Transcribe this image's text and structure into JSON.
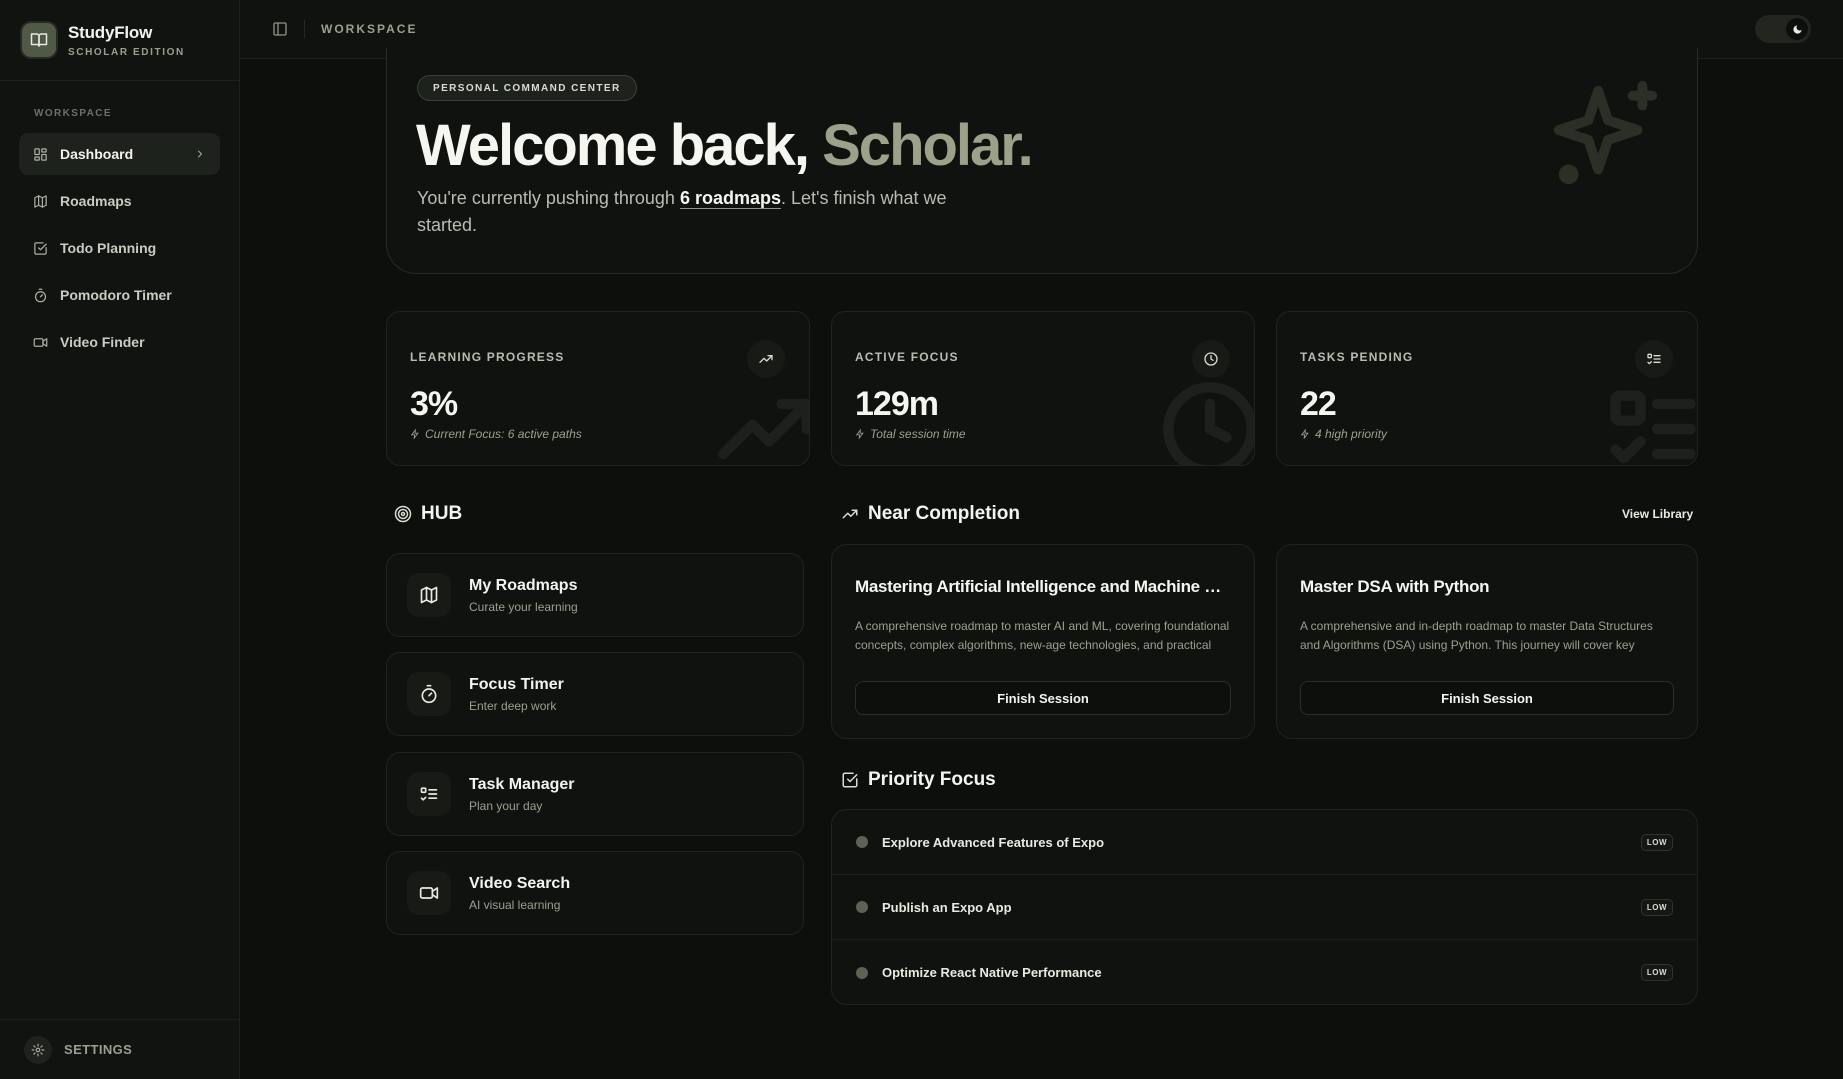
{
  "brand": {
    "name": "StudyFlow",
    "subtitle": "SCHOLAR EDITION"
  },
  "sidebar": {
    "section_label": "WORKSPACE",
    "items": [
      {
        "label": "Dashboard",
        "icon": "dashboard-icon",
        "active": true
      },
      {
        "label": "Roadmaps",
        "icon": "map-icon"
      },
      {
        "label": "Todo Planning",
        "icon": "checkbox-icon"
      },
      {
        "label": "Pomodoro Timer",
        "icon": "timer-icon"
      },
      {
        "label": "Video Finder",
        "icon": "video-icon"
      }
    ],
    "settings_label": "SETTINGS"
  },
  "topbar": {
    "breadcrumb": "WORKSPACE"
  },
  "hero": {
    "pill": "PERSONAL COMMAND CENTER",
    "title_main": "Welcome back, ",
    "title_accent": "Scholar.",
    "text_before": "You're currently pushing through ",
    "text_highlight": "6 roadmaps",
    "text_after": ". Let's finish what we started."
  },
  "stats": [
    {
      "label": "LEARNING PROGRESS",
      "value": "3%",
      "sub": "Current Focus: 6 active paths",
      "icon": "trending-up-icon"
    },
    {
      "label": "ACTIVE FOCUS",
      "value": "129m",
      "sub": "Total session time",
      "icon": "clock-icon"
    },
    {
      "label": "TASKS PENDING",
      "value": "22",
      "sub": "4 high priority",
      "icon": "list-check-icon"
    }
  ],
  "hub": {
    "title": "HUB",
    "cards": [
      {
        "title": "My Roadmaps",
        "sub": "Curate your learning",
        "icon": "map-icon"
      },
      {
        "title": "Focus Timer",
        "sub": "Enter deep work",
        "icon": "timer-icon"
      },
      {
        "title": "Task Manager",
        "sub": "Plan your day",
        "icon": "list-check-icon"
      },
      {
        "title": "Video Search",
        "sub": "AI visual learning",
        "icon": "video-icon"
      }
    ]
  },
  "near_completion": {
    "title": "Near Completion",
    "view_library": "View Library",
    "courses": [
      {
        "title": "Mastering Artificial Intelligence and Machine Learning",
        "desc": "A comprehensive roadmap to master AI and ML, covering foundational concepts, complex algorithms, new-age technologies, and practical applications.",
        "button": "Finish Session"
      },
      {
        "title": "Master DSA with Python",
        "desc": "A comprehensive and in-depth roadmap to master Data Structures and Algorithms (DSA) using Python. This journey will cover key concepts.",
        "button": "Finish Session"
      }
    ]
  },
  "priority": {
    "title": "Priority Focus",
    "items": [
      {
        "text": "Explore Advanced Features of Expo",
        "badge": "LOW"
      },
      {
        "text": "Publish an Expo App",
        "badge": "LOW"
      },
      {
        "text": "Optimize React Native Performance",
        "badge": "LOW"
      }
    ]
  },
  "colors": {
    "background": "#0d0f0c",
    "accent": "#9aa28a",
    "card": "#0f120e",
    "border": "#20241d"
  }
}
